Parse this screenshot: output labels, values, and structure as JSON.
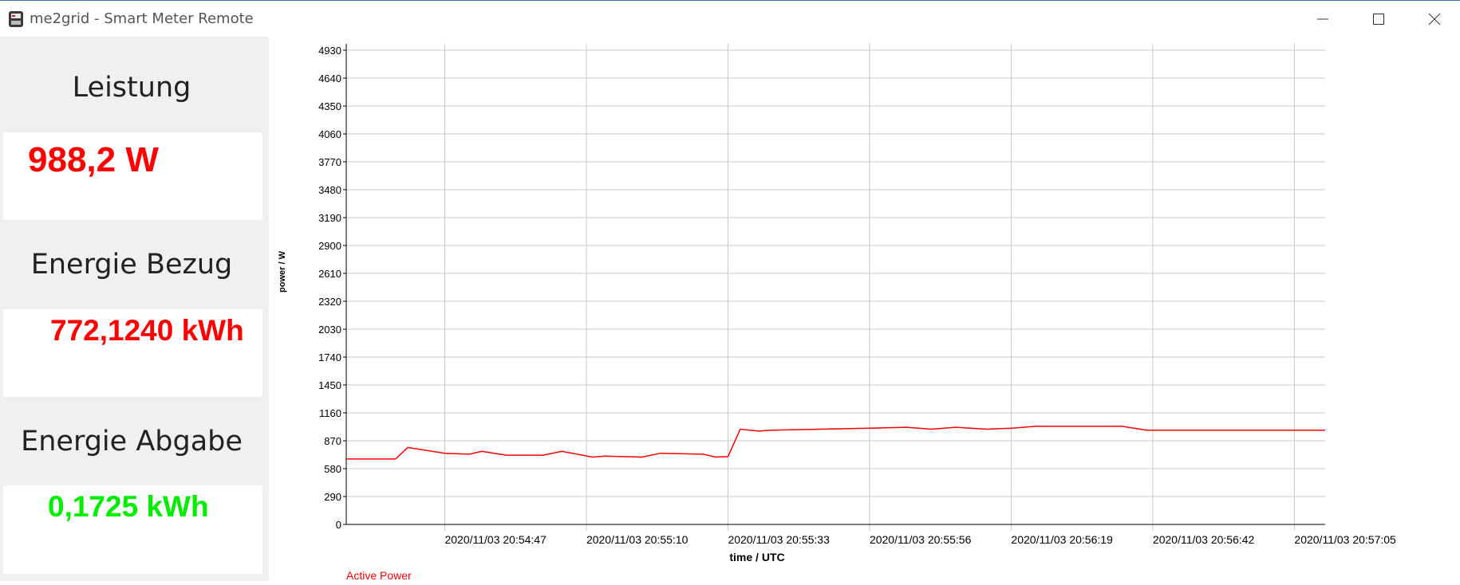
{
  "window": {
    "title": "me2grid - Smart Meter Remote",
    "icons": [
      "meter-app-icon",
      "minimize-icon",
      "maximize-icon",
      "close-icon"
    ]
  },
  "panels": {
    "power": {
      "label": "Leistung",
      "value": "988,2 W",
      "color": "#ff0000"
    },
    "energy_import": {
      "label": "Energie Bezug",
      "value": "772,1240 kWh",
      "color": "#ff0000"
    },
    "energy_export": {
      "label": "Energie Abgabe",
      "value": "0,1725 kWh",
      "color": "#00ee00"
    }
  },
  "colors": {
    "series": "#ff0000",
    "grid": "#c8c8c8",
    "sidebar": "#f0f0f0"
  },
  "chart_data": {
    "type": "line",
    "xlabel": "time / UTC",
    "ylabel": "power / W",
    "ylim": [
      0,
      4930
    ],
    "y_ticks": [
      "0",
      "290",
      "580",
      "870",
      "1160",
      "1450",
      "1740",
      "2030",
      "2320",
      "2610",
      "2900",
      "3190",
      "3480",
      "3770",
      "4060",
      "4350",
      "4640",
      "4930"
    ],
    "x_ticks": [
      "2020/11/03 20:54:47",
      "2020/11/03 20:55:10",
      "2020/11/03 20:55:33",
      "2020/11/03 20:55:56",
      "2020/11/03 20:56:19",
      "2020/11/03 20:56:42",
      "2020/11/03 20:57:05"
    ],
    "grid": true,
    "legend_position": "bottom-left",
    "series": [
      {
        "name": "Active Power",
        "color": "#ff0000",
        "x": [
          "2020/11/03 20:54:31",
          "2020/11/03 20:54:39",
          "2020/11/03 20:54:41",
          "2020/11/03 20:54:43",
          "2020/11/03 20:54:47",
          "2020/11/03 20:54:51",
          "2020/11/03 20:54:53",
          "2020/11/03 20:54:57",
          "2020/11/03 20:55:03",
          "2020/11/03 20:55:06",
          "2020/11/03 20:55:11",
          "2020/11/03 20:55:13",
          "2020/11/03 20:55:19",
          "2020/11/03 20:55:22",
          "2020/11/03 20:55:29",
          "2020/11/03 20:55:31",
          "2020/11/03 20:55:33",
          "2020/11/03 20:55:35",
          "2020/11/03 20:55:38",
          "2020/11/03 20:55:40",
          "2020/11/03 20:55:56",
          "2020/11/03 20:56:02",
          "2020/11/03 20:56:06",
          "2020/11/03 20:56:10",
          "2020/11/03 20:56:15",
          "2020/11/03 20:56:19",
          "2020/11/03 20:56:23",
          "2020/11/03 20:56:30",
          "2020/11/03 20:56:37",
          "2020/11/03 20:56:41",
          "2020/11/03 20:56:58",
          "2020/11/03 20:57:00",
          "2020/11/03 20:57:10"
        ],
        "values": [
          680,
          680,
          800,
          780,
          740,
          730,
          760,
          720,
          720,
          760,
          700,
          710,
          700,
          740,
          730,
          700,
          705,
          990,
          970,
          980,
          1000,
          1010,
          990,
          1010,
          990,
          1000,
          1020,
          1020,
          1020,
          980,
          980,
          980,
          980
        ]
      }
    ]
  }
}
